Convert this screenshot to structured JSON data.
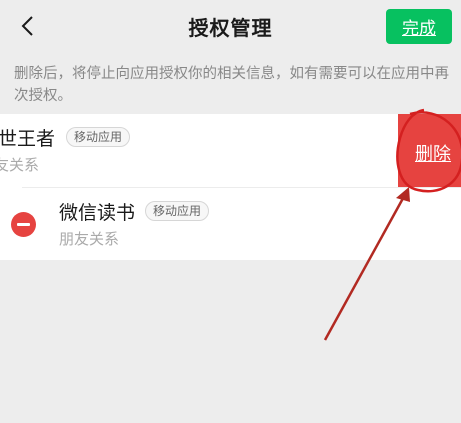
{
  "header": {
    "title": "授权管理",
    "done_label": "完成",
    "back_icon": "chevron-left-icon"
  },
  "notice": "删除后，将停止向应用授权你的相关信息，如有需要可以在应用中再次授权。",
  "apps": [
    {
      "name": "世王者",
      "badge": "移动应用",
      "permission": "友关系",
      "swiped": true
    },
    {
      "name": "微信读书",
      "badge": "移动应用",
      "permission": "朋友关系",
      "swiped": false
    }
  ],
  "delete_label": "删除",
  "colors": {
    "accent_green": "#07c160",
    "danger_red": "#e64340",
    "annotation_red": "#d42020"
  }
}
